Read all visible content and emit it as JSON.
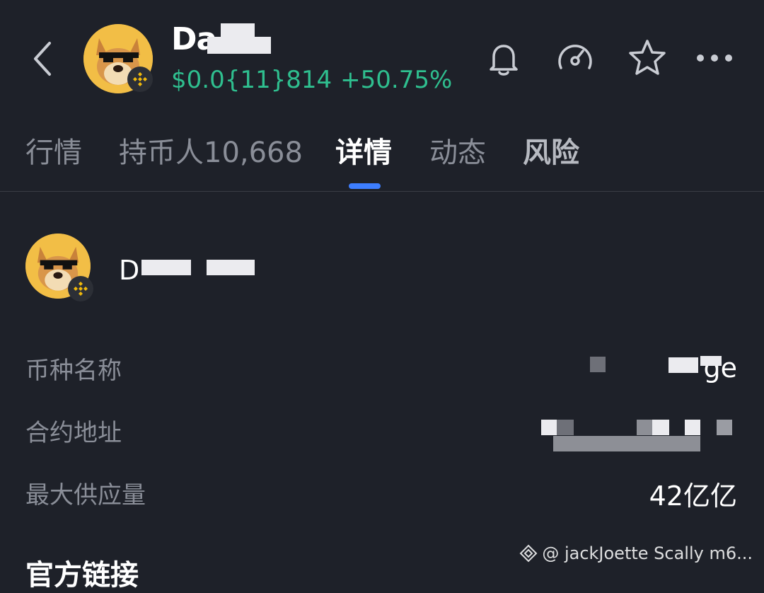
{
  "header": {
    "token_name": "Da",
    "price": "$0.0{11}814",
    "change": "+50.75%",
    "icons": [
      "back-icon",
      "bell-icon",
      "speedometer-icon",
      "star-icon",
      "more-icon"
    ]
  },
  "tabs": [
    {
      "label": "行情"
    },
    {
      "label": "持币人10,668"
    },
    {
      "label": "详情"
    },
    {
      "label": "动态"
    },
    {
      "label": "风险"
    }
  ],
  "token": {
    "name": "D"
  },
  "info": [
    {
      "label": "币种名称",
      "value": "ge"
    },
    {
      "label": "合约地址",
      "value": ""
    },
    {
      "label": "最大供应量",
      "value": "42亿亿"
    }
  ],
  "section": {
    "title": "官方链接"
  },
  "watermark": {
    "text": "@ jackJoette Scally m6..."
  },
  "colors": {
    "background": "#1e2129",
    "positive": "#2fbf8f",
    "accent": "#3d7eff",
    "muted_text": "#8a8e98"
  }
}
